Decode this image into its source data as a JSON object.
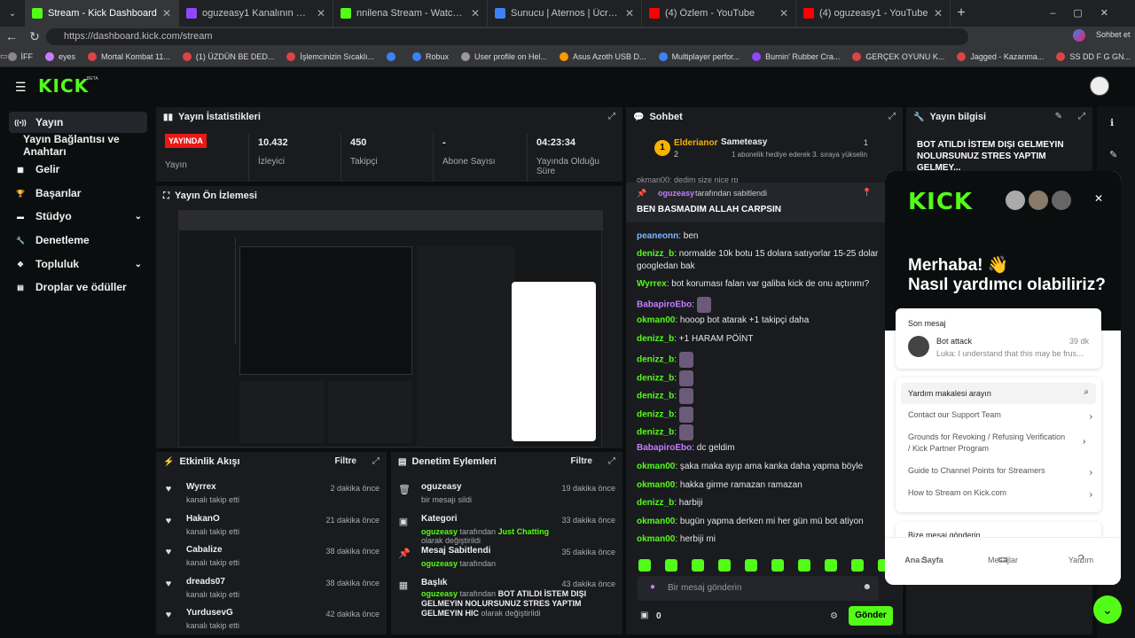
{
  "tabs": [
    {
      "label": "Stream - Kick Dashboard",
      "color": "#53fc18",
      "active": true
    },
    {
      "label": "oguzeasy1 Kanalının Videoları - Tw",
      "color": "#9146ff"
    },
    {
      "label": "nnilena Stream - Watch Live on Kick",
      "color": "#53fc18"
    },
    {
      "label": "Sunucu | Aternos | Ücretsiz Minecraft",
      "color": "#3b82f6"
    },
    {
      "label": "(4) Özlem - YouTube",
      "color": "#ff0000"
    },
    {
      "label": "(4) oguzeasy1 - YouTube",
      "color": "#ff0000"
    }
  ],
  "browser": {
    "url": "https://dashboard.kick.com/stream",
    "sync": "Sohbet et"
  },
  "bookmarks": [
    "İFF",
    "eyes",
    "Mortal Kombat 11...",
    "(1) ÜZDÜN BE DED...",
    "İşlemcinizin Sıcaklı...",
    "",
    "Robux",
    "User profile on Hel...",
    "Asus Azoth USB D...",
    "Multiplayer perfor...",
    "Burnin' Rubber Cra...",
    "GERÇEK OYUNU K...",
    "Jagged - Kazanma...",
    "SS DD F G GN..."
  ],
  "kick": {
    "logo": "KICK",
    "beta": "BETA"
  },
  "sidebar": [
    {
      "label": "Yayın",
      "icon": "broadcast-icon",
      "active": true
    },
    {
      "label": "Yayın Bağlantısı ve Anahtarı",
      "icon": ""
    },
    {
      "label": "Gelir",
      "icon": "revenue-icon"
    },
    {
      "label": "Başarılar",
      "icon": "trophy-icon"
    },
    {
      "label": "Stüdyo",
      "icon": "studio-icon",
      "chev": true
    },
    {
      "label": "Denetleme",
      "icon": "wrench-icon"
    },
    {
      "label": "Topluluk",
      "icon": "community-icon",
      "chev": true
    },
    {
      "label": "Droplar ve ödüller",
      "icon": "drops-icon"
    }
  ],
  "stats": {
    "title": "Yayın İstatistikleri",
    "live": "YAYINDA",
    "items": [
      {
        "value": "",
        "label": "Yayın"
      },
      {
        "value": "10.432",
        "label": "İzleyici"
      },
      {
        "value": "450",
        "label": "Takipçi"
      },
      {
        "value": "-",
        "label": "Abone Sayısı"
      },
      {
        "value": "04:23:34",
        "label": "Yayında Olduğu Süre"
      }
    ]
  },
  "preview": {
    "title": "Yayın Ön İzlemesi"
  },
  "activity": {
    "title": "Etkinlik Akışı",
    "filter": "Filtre",
    "items": [
      {
        "name": "Wyrrex",
        "sub": "kanalı takip etti",
        "time": "2 dakika önce"
      },
      {
        "name": "HakanO",
        "sub": "kanalı takip etti",
        "time": "21 dakika önce"
      },
      {
        "name": "Cabalize",
        "sub": "kanalı takip etti",
        "time": "38 dakika önce"
      },
      {
        "name": "dreads07",
        "sub": "kanalı takip etti",
        "time": "38 dakika önce"
      },
      {
        "name": "YurdusevG",
        "sub": "kanalı takip etti",
        "time": "42 dakika önce"
      }
    ]
  },
  "modlog": {
    "title": "Denetim Eylemleri",
    "filter": "Filtre",
    "items": [
      {
        "name": "oguzeasy",
        "sub": "bir mesajı sildi",
        "time": "19 dakika önce"
      },
      {
        "name": "Kategori",
        "user": "oguzeasy",
        "mid": "tarafından",
        "hl": "Just Chatting",
        "end": "olarak değiştirildi",
        "time": "33 dakika önce"
      },
      {
        "name": "Mesaj Sabitlendi",
        "user": "oguzeasy",
        "mid": "tarafından",
        "time": "35 dakika önce"
      },
      {
        "name": "Başlık",
        "user": "oguzeasy",
        "mid": "tarafından",
        "hl": "BOT ATILDI İSTEM DIŞI GELMEYIN NOLURSUNUZ STRES YAPTIM GELMEYIN HIC",
        "end": "olarak değiştirildi",
        "time": "43 dakika önce"
      }
    ]
  },
  "chat": {
    "title": "Sohbet",
    "gifter1": "Elderianor",
    "gifter1_count": "2",
    "gifter2": "Sameteasy",
    "gifter2_count": "1",
    "gift_text": "1 abonelik hediye ederek 3. sıraya yükselin",
    "badge_rank": "1",
    "pinned_by": "oguzeasy",
    "pinned_suffix": "tarafından sabitlendi",
    "pinned_msg": "BEN BASMADIM ALLAH CARPSIN",
    "top_partial": "okman00: dedim size nice rp",
    "messages": [
      {
        "user": "peaneonn",
        "color": "#7fb7ff",
        "text": "ben"
      },
      {
        "user": "denizz_b",
        "color": "#53fc18",
        "text": "normalde 10k botu 15 dolara satıyorlar 15-25 dolar"
      },
      {
        "user": "",
        "color": "",
        "text": "googledan bak"
      },
      {
        "user": "Wyrrex",
        "color": "#53fc18",
        "text": "bot koruması falan var galiba kick de onu açtınmı?"
      },
      {
        "user": "BabapiroEbo",
        "color": "#c77dff",
        "text": "",
        "emote": true
      },
      {
        "user": "okman00",
        "color": "#53fc18",
        "text": "hooop bot atarak +1 takipçi daha"
      },
      {
        "user": "denizz_b",
        "color": "#53fc18",
        "text": "+1 HARAM PÖİNT"
      },
      {
        "user": "denizz_b",
        "color": "#53fc18",
        "text": "",
        "emote": true
      },
      {
        "user": "denizz_b",
        "color": "#53fc18",
        "text": "",
        "emote": true
      },
      {
        "user": "denizz_b",
        "color": "#53fc18",
        "text": "",
        "emote": true
      },
      {
        "user": "denizz_b",
        "color": "#53fc18",
        "text": "",
        "emote": true
      },
      {
        "user": "denizz_b",
        "color": "#53fc18",
        "text": "",
        "emote": true
      },
      {
        "user": "BabapiroEbo",
        "color": "#c77dff",
        "text": "dc geldim"
      },
      {
        "user": "okman00",
        "color": "#53fc18",
        "text": "şaka maka ayıp ama kanka daha yapma böyle"
      },
      {
        "user": "okman00",
        "color": "#53fc18",
        "text": "hakka girme ramazan ramazan"
      },
      {
        "user": "denizz_b",
        "color": "#53fc18",
        "text": "harbiji"
      },
      {
        "user": "okman00",
        "color": "#53fc18",
        "text": "bugün yapma derken mi her gün mü bot atiyon"
      },
      {
        "user": "okman00",
        "color": "#53fc18",
        "text": "herbiji mi"
      }
    ],
    "placeholder": "Bir mesaj gönderin",
    "points": "0",
    "send": "Gönder"
  },
  "info": {
    "title": "Yayın bilgisi",
    "text": "BOT ATILDI İSTEM DIŞI GELMEYIN NOLURSUNUZ STRES YAPTIM GELMEY..."
  },
  "widget": {
    "logo": "KICK",
    "greet1": "Merhaba! 👋",
    "greet2": "Nasıl yardımcı olabiliriz?",
    "recent_label": "Son mesaj",
    "recent_name": "Bot attack",
    "recent_time": "39 dk",
    "recent_preview": "Luka: I understand that this may be frus...",
    "search_label": "Yardım makalesi arayın",
    "articles": [
      "Contact our Support Team",
      "Grounds for Revoking / Refusing Verification / Kick Partner Program",
      "Guide to Channel Points for Streamers",
      "How to Stream on Kick.com"
    ],
    "send_us": "Bize mesaj gönderin",
    "nav": [
      "Ana Sayfa",
      "Mesajlar",
      "Yardım"
    ]
  }
}
